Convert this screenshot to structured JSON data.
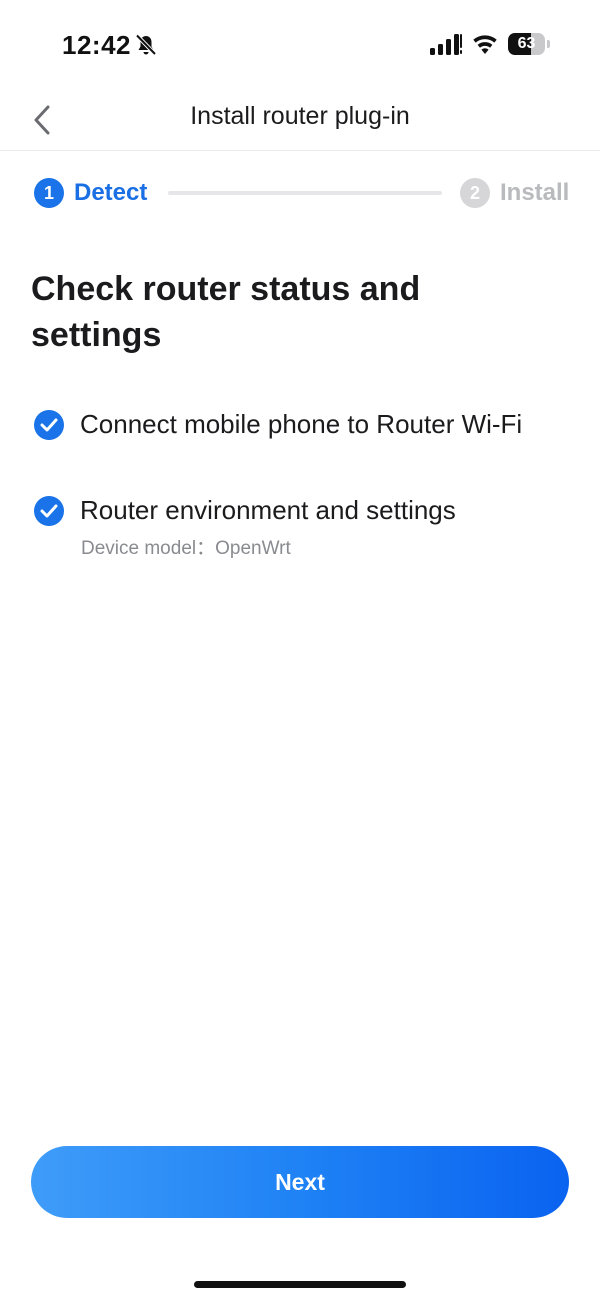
{
  "status_bar": {
    "time": "12:42",
    "battery_level": "63",
    "battery_percent": 63,
    "icons": [
      "bell-slash-icon",
      "cellular-signal-icon",
      "wifi-icon",
      "battery-icon"
    ]
  },
  "nav": {
    "back_icon": "chevron-left-icon",
    "title": "Install router plug-in"
  },
  "stepper": {
    "steps": [
      {
        "number": "1",
        "label": "Detect",
        "state": "active"
      },
      {
        "number": "2",
        "label": "Install",
        "state": "inactive"
      }
    ]
  },
  "content": {
    "heading": "Check router status and settings",
    "checks": [
      {
        "label": "Connect mobile phone to Router Wi-Fi",
        "icon": "check-circle-icon",
        "checked": true
      },
      {
        "label": "Router environment and settings",
        "icon": "check-circle-icon",
        "checked": true,
        "detail": "Device model：OpenWrt"
      }
    ]
  },
  "footer": {
    "next_label": "Next"
  },
  "colors": {
    "accent": "#1a73e8",
    "inactive": "#b9babd",
    "button_gradient_start": "#3f9cf9",
    "button_gradient_end": "#0a63f0"
  }
}
